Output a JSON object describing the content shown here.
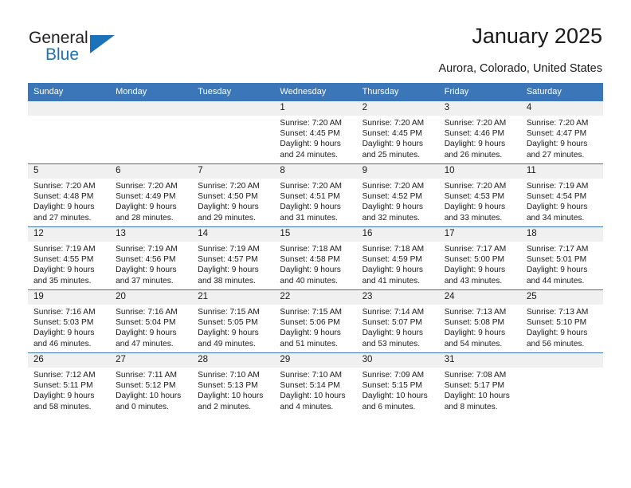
{
  "brand": {
    "name_top": "General",
    "name_bottom": "Blue",
    "accent_color": "#1b72bb",
    "triangle_icon": "triangle-right-icon"
  },
  "header": {
    "title": "January 2025",
    "subtitle": "Aurora, Colorado, United States",
    "header_bg": "#3b76b9",
    "daynum_bg": "#f0f0f0"
  },
  "weekday_headers": [
    "Sunday",
    "Monday",
    "Tuesday",
    "Wednesday",
    "Thursday",
    "Friday",
    "Saturday"
  ],
  "labels": {
    "sunrise_prefix": "Sunrise:",
    "sunset_prefix": "Sunset:",
    "daylight_prefix": "Daylight:"
  },
  "weeks": [
    [
      {
        "day": "",
        "empty": true,
        "sunrise": "",
        "sunset": "",
        "daylight": ""
      },
      {
        "day": "",
        "empty": true,
        "sunrise": "",
        "sunset": "",
        "daylight": ""
      },
      {
        "day": "",
        "empty": true,
        "sunrise": "",
        "sunset": "",
        "daylight": ""
      },
      {
        "day": "1",
        "sunrise": "Sunrise: 7:20 AM",
        "sunset": "Sunset: 4:45 PM",
        "daylight": "Daylight: 9 hours and 24 minutes."
      },
      {
        "day": "2",
        "sunrise": "Sunrise: 7:20 AM",
        "sunset": "Sunset: 4:45 PM",
        "daylight": "Daylight: 9 hours and 25 minutes."
      },
      {
        "day": "3",
        "sunrise": "Sunrise: 7:20 AM",
        "sunset": "Sunset: 4:46 PM",
        "daylight": "Daylight: 9 hours and 26 minutes."
      },
      {
        "day": "4",
        "sunrise": "Sunrise: 7:20 AM",
        "sunset": "Sunset: 4:47 PM",
        "daylight": "Daylight: 9 hours and 27 minutes."
      }
    ],
    [
      {
        "day": "5",
        "sunrise": "Sunrise: 7:20 AM",
        "sunset": "Sunset: 4:48 PM",
        "daylight": "Daylight: 9 hours and 27 minutes."
      },
      {
        "day": "6",
        "sunrise": "Sunrise: 7:20 AM",
        "sunset": "Sunset: 4:49 PM",
        "daylight": "Daylight: 9 hours and 28 minutes."
      },
      {
        "day": "7",
        "sunrise": "Sunrise: 7:20 AM",
        "sunset": "Sunset: 4:50 PM",
        "daylight": "Daylight: 9 hours and 29 minutes."
      },
      {
        "day": "8",
        "sunrise": "Sunrise: 7:20 AM",
        "sunset": "Sunset: 4:51 PM",
        "daylight": "Daylight: 9 hours and 31 minutes."
      },
      {
        "day": "9",
        "sunrise": "Sunrise: 7:20 AM",
        "sunset": "Sunset: 4:52 PM",
        "daylight": "Daylight: 9 hours and 32 minutes."
      },
      {
        "day": "10",
        "sunrise": "Sunrise: 7:20 AM",
        "sunset": "Sunset: 4:53 PM",
        "daylight": "Daylight: 9 hours and 33 minutes."
      },
      {
        "day": "11",
        "sunrise": "Sunrise: 7:19 AM",
        "sunset": "Sunset: 4:54 PM",
        "daylight": "Daylight: 9 hours and 34 minutes."
      }
    ],
    [
      {
        "day": "12",
        "sunrise": "Sunrise: 7:19 AM",
        "sunset": "Sunset: 4:55 PM",
        "daylight": "Daylight: 9 hours and 35 minutes."
      },
      {
        "day": "13",
        "sunrise": "Sunrise: 7:19 AM",
        "sunset": "Sunset: 4:56 PM",
        "daylight": "Daylight: 9 hours and 37 minutes."
      },
      {
        "day": "14",
        "sunrise": "Sunrise: 7:19 AM",
        "sunset": "Sunset: 4:57 PM",
        "daylight": "Daylight: 9 hours and 38 minutes."
      },
      {
        "day": "15",
        "sunrise": "Sunrise: 7:18 AM",
        "sunset": "Sunset: 4:58 PM",
        "daylight": "Daylight: 9 hours and 40 minutes."
      },
      {
        "day": "16",
        "sunrise": "Sunrise: 7:18 AM",
        "sunset": "Sunset: 4:59 PM",
        "daylight": "Daylight: 9 hours and 41 minutes."
      },
      {
        "day": "17",
        "sunrise": "Sunrise: 7:17 AM",
        "sunset": "Sunset: 5:00 PM",
        "daylight": "Daylight: 9 hours and 43 minutes."
      },
      {
        "day": "18",
        "sunrise": "Sunrise: 7:17 AM",
        "sunset": "Sunset: 5:01 PM",
        "daylight": "Daylight: 9 hours and 44 minutes."
      }
    ],
    [
      {
        "day": "19",
        "sunrise": "Sunrise: 7:16 AM",
        "sunset": "Sunset: 5:03 PM",
        "daylight": "Daylight: 9 hours and 46 minutes."
      },
      {
        "day": "20",
        "sunrise": "Sunrise: 7:16 AM",
        "sunset": "Sunset: 5:04 PM",
        "daylight": "Daylight: 9 hours and 47 minutes."
      },
      {
        "day": "21",
        "sunrise": "Sunrise: 7:15 AM",
        "sunset": "Sunset: 5:05 PM",
        "daylight": "Daylight: 9 hours and 49 minutes."
      },
      {
        "day": "22",
        "sunrise": "Sunrise: 7:15 AM",
        "sunset": "Sunset: 5:06 PM",
        "daylight": "Daylight: 9 hours and 51 minutes."
      },
      {
        "day": "23",
        "sunrise": "Sunrise: 7:14 AM",
        "sunset": "Sunset: 5:07 PM",
        "daylight": "Daylight: 9 hours and 53 minutes."
      },
      {
        "day": "24",
        "sunrise": "Sunrise: 7:13 AM",
        "sunset": "Sunset: 5:08 PM",
        "daylight": "Daylight: 9 hours and 54 minutes."
      },
      {
        "day": "25",
        "sunrise": "Sunrise: 7:13 AM",
        "sunset": "Sunset: 5:10 PM",
        "daylight": "Daylight: 9 hours and 56 minutes."
      }
    ],
    [
      {
        "day": "26",
        "sunrise": "Sunrise: 7:12 AM",
        "sunset": "Sunset: 5:11 PM",
        "daylight": "Daylight: 9 hours and 58 minutes."
      },
      {
        "day": "27",
        "sunrise": "Sunrise: 7:11 AM",
        "sunset": "Sunset: 5:12 PM",
        "daylight": "Daylight: 10 hours and 0 minutes."
      },
      {
        "day": "28",
        "sunrise": "Sunrise: 7:10 AM",
        "sunset": "Sunset: 5:13 PM",
        "daylight": "Daylight: 10 hours and 2 minutes."
      },
      {
        "day": "29",
        "sunrise": "Sunrise: 7:10 AM",
        "sunset": "Sunset: 5:14 PM",
        "daylight": "Daylight: 10 hours and 4 minutes."
      },
      {
        "day": "30",
        "sunrise": "Sunrise: 7:09 AM",
        "sunset": "Sunset: 5:15 PM",
        "daylight": "Daylight: 10 hours and 6 minutes."
      },
      {
        "day": "31",
        "sunrise": "Sunrise: 7:08 AM",
        "sunset": "Sunset: 5:17 PM",
        "daylight": "Daylight: 10 hours and 8 minutes."
      },
      {
        "day": "",
        "empty": true,
        "sunrise": "",
        "sunset": "",
        "daylight": ""
      }
    ]
  ]
}
